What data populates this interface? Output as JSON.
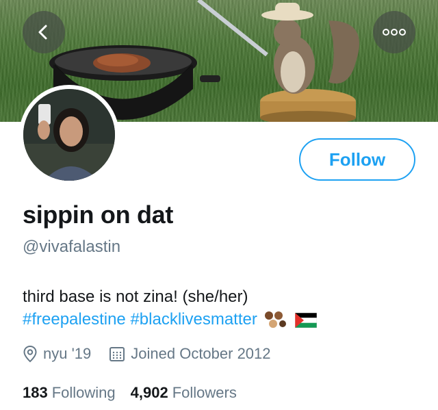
{
  "header": {
    "back_icon": "chevron-left-icon",
    "more_icon": "more-horizontal-icon"
  },
  "profile": {
    "display_name": "sippin on dat",
    "handle": "@vivafalastin",
    "bio_text": "third base is not zina! (she/her)",
    "hashtags": [
      "#freepalestine",
      "#blacklivesmatter"
    ],
    "bio_emoji": [
      "raised-fists-emoji",
      "palestine-flag-emoji"
    ],
    "location": "nyu '19",
    "joined": "Joined October 2012",
    "following_count": "183",
    "following_label": "Following",
    "followers_count": "4,902",
    "followers_label": "Followers"
  },
  "actions": {
    "follow_label": "Follow"
  },
  "colors": {
    "accent": "#1da1f2",
    "secondary_text": "#657786",
    "primary_text": "#14171a"
  }
}
